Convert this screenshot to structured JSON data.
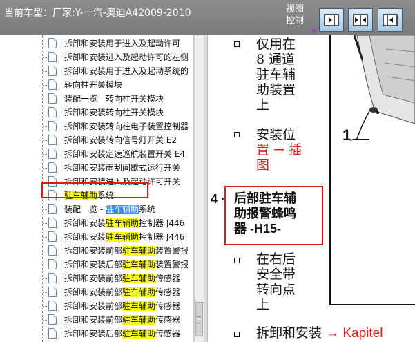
{
  "topbar": {
    "car_title": "当前车型：厂家:Y-一汽-奥迪A42009-2010",
    "view_control": "视图控制",
    "buttons": [
      {
        "name": "show-right-pane",
        "icon": "arrow-right-icon"
      },
      {
        "name": "show-both-panes",
        "icon": "split-arrows-icon"
      },
      {
        "name": "show-left-pane",
        "icon": "arrow-left-icon"
      }
    ]
  },
  "tree": {
    "items": [
      {
        "label": "拆卸和安装用于进入及起动许可",
        "segments": [
          {
            "t": "拆卸和安装用于进入及起动许可",
            "h": ""
          }
        ]
      },
      {
        "label": "拆卸和安装进入及起动许可的左侧",
        "segments": [
          {
            "t": "拆卸和安装进入及起动许可的左侧",
            "h": ""
          }
        ]
      },
      {
        "label": "拆卸和安装用于进入及起动系统的",
        "segments": [
          {
            "t": "拆卸和安装用于进入及起动系统的",
            "h": ""
          }
        ]
      },
      {
        "label": "转向柱开关模块",
        "segments": [
          {
            "t": "转向柱开关模块",
            "h": ""
          }
        ]
      },
      {
        "label": "装配一览 - 转向柱开关模块",
        "segments": [
          {
            "t": "装配一览 - 转向柱开关模块",
            "h": ""
          }
        ]
      },
      {
        "label": "拆卸和安装转向柱开关模块",
        "segments": [
          {
            "t": "拆卸和安装转向柱开关模块",
            "h": ""
          }
        ]
      },
      {
        "label": "拆卸和安装转向柱电子装置控制器",
        "segments": [
          {
            "t": "拆卸和安装转向柱电子装置控制器",
            "h": ""
          }
        ]
      },
      {
        "label": "拆卸和安装转向信号灯开关 E2",
        "segments": [
          {
            "t": "拆卸和安装转向信号灯开关 E2",
            "h": ""
          }
        ]
      },
      {
        "label": "拆卸和安装定速巡航装置开关 E4",
        "segments": [
          {
            "t": "拆卸和安装定速巡航装置开关 E4",
            "h": ""
          }
        ]
      },
      {
        "label": "拆卸和安装雨刮间歇式运行开关",
        "segments": [
          {
            "t": "拆卸和安装雨刮间歇式运行开关",
            "h": ""
          }
        ]
      },
      {
        "label": "拆卸和安装进入及起动许可开关",
        "segments": [
          {
            "t": "拆卸和安装进入及起动许可开关",
            "h": ""
          }
        ]
      },
      {
        "label": "驻车辅助系统",
        "segments": [
          {
            "t": "驻车辅助",
            "h": "y"
          },
          {
            "t": "系统",
            "h": ""
          }
        ]
      },
      {
        "label": "装配一览 - 驻车辅助系统",
        "segments": [
          {
            "t": "装配一览 - ",
            "h": ""
          },
          {
            "t": "驻车辅助",
            "h": "b"
          },
          {
            "t": "系统",
            "h": ""
          }
        ]
      },
      {
        "label": "拆卸和安装驻车辅助控制器 J446",
        "segments": [
          {
            "t": "拆卸和安装",
            "h": ""
          },
          {
            "t": "驻车辅助",
            "h": "y"
          },
          {
            "t": "控制器 J446",
            "h": ""
          }
        ]
      },
      {
        "label": "拆卸和安装驻车辅助控制器 J446",
        "segments": [
          {
            "t": "拆卸和安装",
            "h": ""
          },
          {
            "t": "驻车辅助",
            "h": "y"
          },
          {
            "t": "控制器 J446",
            "h": ""
          }
        ]
      },
      {
        "label": "拆卸和安装前部驻车辅助装置警报",
        "segments": [
          {
            "t": "拆卸和安装前部",
            "h": ""
          },
          {
            "t": "驻车辅助",
            "h": "y"
          },
          {
            "t": "装置警报",
            "h": ""
          }
        ]
      },
      {
        "label": "拆卸和安装后部驻车辅助装置警报",
        "segments": [
          {
            "t": "拆卸和安装后部",
            "h": ""
          },
          {
            "t": "驻车辅助",
            "h": "y"
          },
          {
            "t": "装置警报",
            "h": ""
          }
        ]
      },
      {
        "label": "拆卸和安装前部驻车辅助传感器",
        "segments": [
          {
            "t": "拆卸和安装前部",
            "h": ""
          },
          {
            "t": "驻车辅助",
            "h": "y"
          },
          {
            "t": "传感器",
            "h": ""
          }
        ]
      },
      {
        "label": "拆卸和安装前部驻车辅助传感器",
        "segments": [
          {
            "t": "拆卸和安装前部",
            "h": ""
          },
          {
            "t": "驻车辅助",
            "h": "y"
          },
          {
            "t": "传感器",
            "h": ""
          }
        ]
      },
      {
        "label": "拆卸和安装前部驻车辅助传感器",
        "segments": [
          {
            "t": "拆卸和安装前部",
            "h": ""
          },
          {
            "t": "驻车辅助",
            "h": "y"
          },
          {
            "t": "传感器",
            "h": ""
          }
        ]
      },
      {
        "label": "拆卸和安装前部驻车辅助传感器",
        "segments": [
          {
            "t": "拆卸和安装前部",
            "h": ""
          },
          {
            "t": "驻车辅助",
            "h": "y"
          },
          {
            "t": "传感器",
            "h": ""
          }
        ]
      },
      {
        "label": "拆卸和安装后部驻车辅助传感器",
        "segments": [
          {
            "t": "拆卸和安装后部",
            "h": ""
          },
          {
            "t": "驻车辅助",
            "h": "y"
          },
          {
            "t": "传感器",
            "h": ""
          }
        ]
      }
    ],
    "selected_index": 11
  },
  "document": {
    "bullets": [
      {
        "lines": [
          "仅用在",
          "8 通道",
          "驻车辅",
          "助装置",
          "上"
        ]
      },
      {
        "lines": [
          "安装位",
          "置 → 插",
          "图"
        ],
        "red_from_line": 1
      },
      {
        "lines": [
          "在右后",
          "安全带",
          "转向点",
          "上"
        ]
      },
      {
        "lines": [
          "拆卸和安装 → Kapitel"
        ]
      }
    ],
    "callout": {
      "number": "4 ·",
      "lines": [
        "后部驻车辅",
        "助报警蜂鸣",
        "器 -H15-"
      ]
    },
    "figure_label": "1"
  },
  "colors": {
    "topbar_bg": "#808080",
    "highlight_yellow": "#ffff1c",
    "highlight_blue": "#3c8ee6",
    "annotation_red": "#e01818",
    "link_red": "#e02020"
  }
}
